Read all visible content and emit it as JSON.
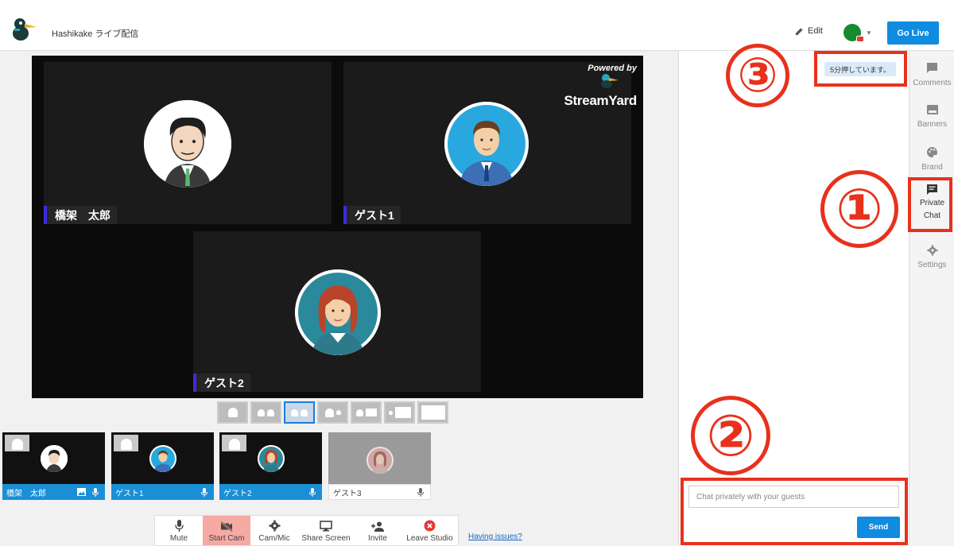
{
  "header": {
    "title": "Hashikake ライブ配信",
    "edit_label": "Edit",
    "go_live_label": "Go Live"
  },
  "stage": {
    "powered_by": "Powered by",
    "brand": "StreamYard",
    "participants": [
      {
        "name": "橋架　太郎"
      },
      {
        "name": "ゲスト1"
      },
      {
        "name": "ゲスト2"
      }
    ]
  },
  "thumbnails": [
    {
      "name": "橋架　太郎"
    },
    {
      "name": "ゲスト1"
    },
    {
      "name": "ゲスト2"
    },
    {
      "name": "ゲスト3"
    }
  ],
  "toolbar": {
    "mute": "Mute",
    "start_cam": "Start Cam",
    "cam_mic": "Cam/Mic",
    "share_screen": "Share Screen",
    "invite": "Invite",
    "leave": "Leave Studio",
    "issues": "Having issues?"
  },
  "side_tabs": {
    "comments": "Comments",
    "banners": "Banners",
    "brand": "Brand",
    "private": "Private",
    "chat": "Chat",
    "settings": "Settings"
  },
  "private_chat": {
    "message": "5分押しています。",
    "placeholder": "Chat privately with your guests",
    "send_label": "Send"
  },
  "annotations": {
    "one": "①",
    "two": "②",
    "three": "③"
  },
  "colors": {
    "accent": "#0f8be0",
    "annotation": "#e8311c",
    "name_tag_bar": "#3d2ae0",
    "cam_off": "#f5aaa4"
  }
}
